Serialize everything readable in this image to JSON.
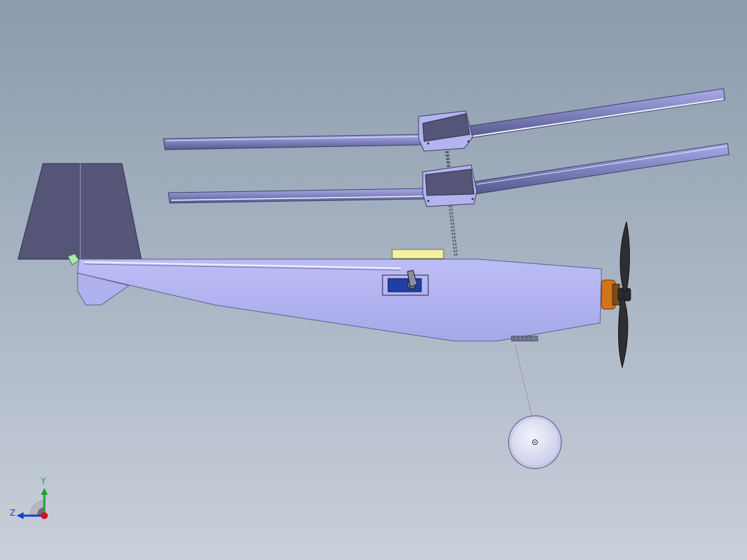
{
  "viewport": {
    "background_top": "#8b9bac",
    "background_bottom": "#c9d0da"
  },
  "model": {
    "body_color": "#b3b4f1",
    "panel_color": "#545577",
    "blade_color": "#8a8dc9",
    "motor_color": "#d2741c",
    "battery_color": "#f4f1a3",
    "servo_color": "#1f3ea6",
    "wheel_color": "#e5e8f7"
  },
  "triad": {
    "y_label": "Y",
    "z_label": "Z",
    "y_color": "#1ea33a",
    "z_color": "#1b3fd0",
    "x_color": "#d01616"
  }
}
